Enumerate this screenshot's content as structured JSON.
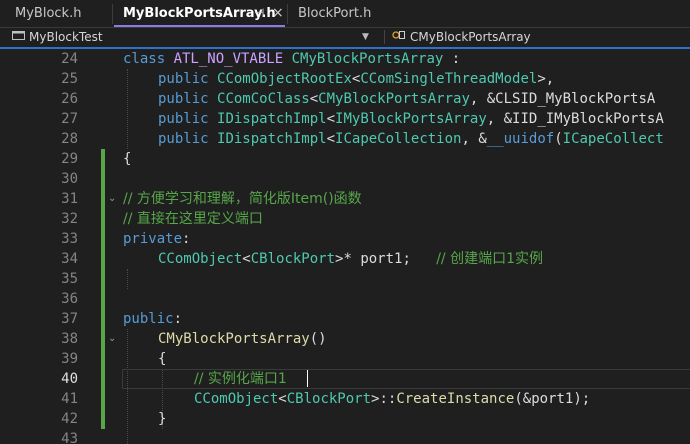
{
  "tabs": [
    {
      "label": "MyBlock.h"
    },
    {
      "label": "MyBlockPortsArray.h",
      "pin": "⊣",
      "close": "×"
    },
    {
      "label": "BlockPort.h"
    }
  ],
  "nav": {
    "project": "MyBlockTest",
    "scope": "CMyBlockPortsArray",
    "project_icon": "project-icon",
    "scope_icon": "class-icon"
  },
  "colors": {
    "keyword": "#569cd6",
    "type": "#4ec9b0",
    "macro": "#c8a2ff",
    "function": "#dcdcaa",
    "comment": "#57a64a",
    "change_bar": "#57a64a",
    "accent": "#2d72c8"
  },
  "editor": {
    "line_numbers": [
      "24",
      "25",
      "26",
      "27",
      "28",
      "29",
      "30",
      "31",
      "32",
      "33",
      "34",
      "35",
      "36",
      "37",
      "38",
      "39",
      "40",
      "41",
      "42",
      "43"
    ],
    "current_line": "40",
    "lines": {
      "l24": {
        "a": "class ",
        "b": "ATL_NO_VTABLE ",
        "c": "CMyBlockPortsArray",
        "d": " :"
      },
      "l25": {
        "a": "public ",
        "b": "CComObjectRootEx",
        "c": "<",
        "d": "CComSingleThreadModel",
        "e": ">,"
      },
      "l26": {
        "a": "public ",
        "b": "CComCoClass",
        "c": "<",
        "d": "CMyBlockPortsArray",
        "e": ", &CLSID_MyBlockPortsA"
      },
      "l27": {
        "a": "public ",
        "b": "IDispatchImpl",
        "c": "<",
        "d": "IMyBlockPortsArray",
        "e": ", &IID_IMyBlockPortsA"
      },
      "l28": {
        "a": "public ",
        "b": "IDispatchImpl",
        "c": "<",
        "d": "ICapeCollection",
        "e": ", &",
        "f": "__uuidof",
        "g": "(",
        "h": "ICapeCollect"
      },
      "l29": {
        "a": "{"
      },
      "l31": {
        "a": "// 方便学习和理解，简化版Item()函数"
      },
      "l32": {
        "a": "// 直接在这里定义端口"
      },
      "l33": {
        "a": "private",
        "b": ":"
      },
      "l34": {
        "a": "CComObject",
        "b": "<",
        "c": "CBlockPort",
        "d": ">* port1;   ",
        "e": "// 创建端口1实例"
      },
      "l37": {
        "a": "public",
        "b": ":"
      },
      "l38": {
        "a": "CMyBlockPortsArray",
        "b": "()"
      },
      "l39": {
        "a": "{"
      },
      "l40": {
        "a": "// 实例化端口1"
      },
      "l41": {
        "a": "CComObject",
        "b": "<",
        "c": "CBlockPort",
        "d": ">::",
        "e": "CreateInstance",
        "f": "(&port1);"
      },
      "l42": {
        "a": "}"
      }
    }
  }
}
